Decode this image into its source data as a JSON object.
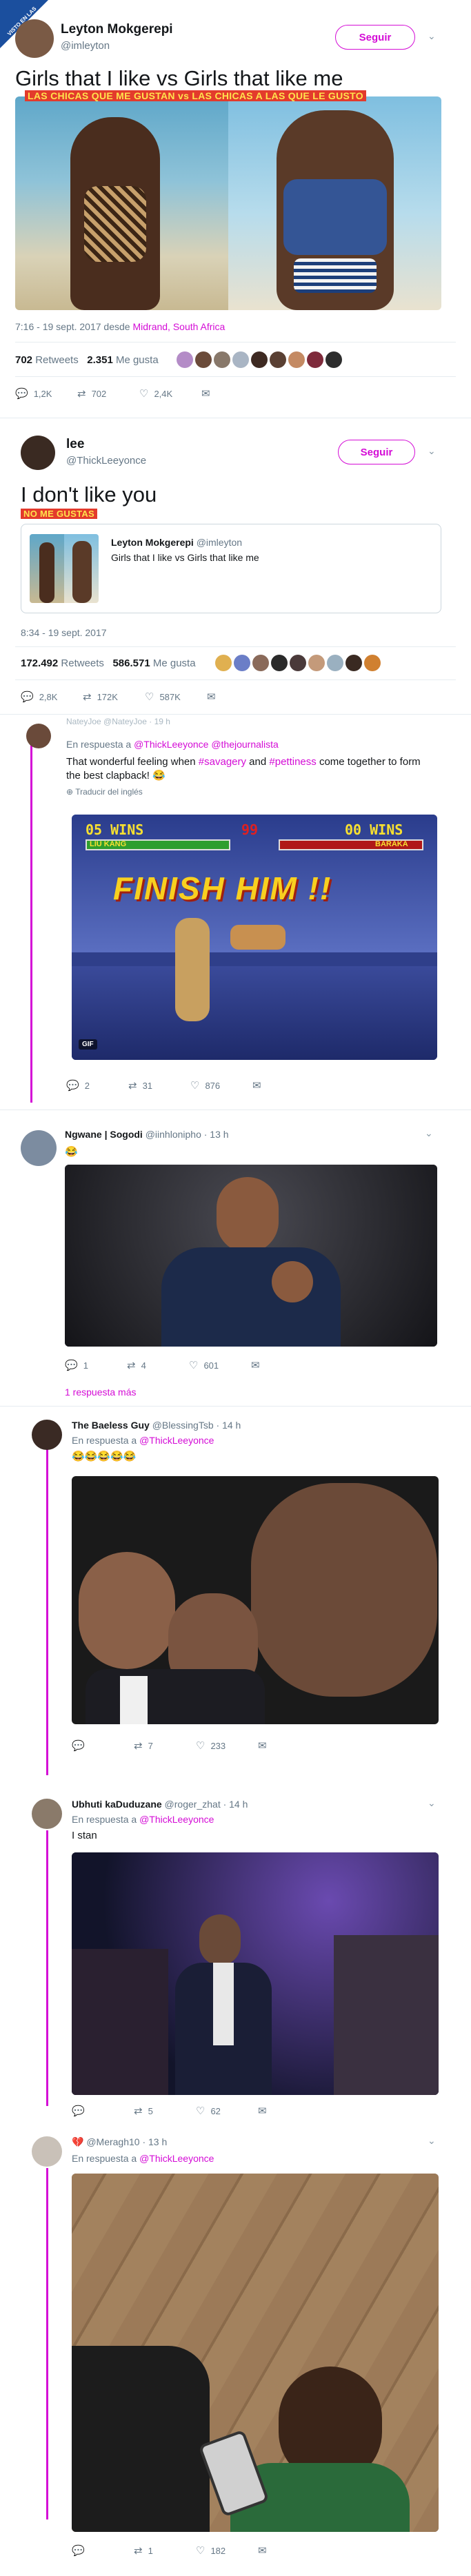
{
  "watermark": {
    "text": "VISTO EN LAS REDES"
  },
  "tweet1": {
    "name": "Leyton Mokgerepi",
    "handle": "@imleyton",
    "follow": "Seguir",
    "text": "Girls that I like vs Girls  that like me",
    "caption": "LAS CHICAS QUE ME GUSTAN vs LAS CHICAS A LAS QUE LE GUSTO",
    "time": "7:16 - 19 sept. 2017 desde ",
    "place": "Midrand, South Africa",
    "retweets": "702",
    "retweets_label": " Retweets",
    "likes": "2.351",
    "likes_label": " Me gusta",
    "actions": {
      "reply": "1,2K",
      "retweet": "702",
      "like": "2,4K"
    }
  },
  "tweet2": {
    "name": "lee",
    "handle": "@ThickLeeyonce",
    "follow": "Seguir",
    "text": "I don't like you",
    "caption": "NO ME GUSTAS",
    "quote_name": "Leyton Mokgerepi",
    "quote_handle": "@imleyton",
    "quote_text": "Girls that I like vs Girls  that like me",
    "time": "8:34 - 19 sept. 2017",
    "retweets": "172.492",
    "retweets_label": " Retweets",
    "likes": "586.571",
    "likes_label": " Me gusta",
    "actions": {
      "reply": "2,8K",
      "retweet": "172K",
      "like": "587K"
    }
  },
  "reply1": {
    "header": "NateyJoe @NateyJoe · 19 h",
    "in_reply": "En respuesta a ",
    "mentions": "@ThickLeeyonce @thejournalista",
    "text_a": "That wonderful feeling when ",
    "tag1": "#savagery",
    "text_b": " and ",
    "tag2": "#pettiness",
    "text_c": " come together to form the best clapback! 😂",
    "translate": "Traducir del inglés",
    "game": {
      "p1": "05 WINS",
      "p2": "00 WINS",
      "timer": "99",
      "n1": "LIU KANG",
      "n2": "BARAKA",
      "finish": "FINISH HIM !!",
      "badge": "GIF"
    },
    "actions": {
      "reply": "2",
      "retweet": "31",
      "like": "876"
    }
  },
  "reply2": {
    "name": "Ngwane | Sogodi",
    "handle": " @iinhloniphо · 13 h",
    "text": "😂",
    "actions": {
      "reply": "1",
      "retweet": "4",
      "like": "601"
    },
    "more": "1 respuesta más"
  },
  "reply3": {
    "name": "The Baeless Guy",
    "handle": " @BlessingTsb · 14 h",
    "in_reply": "En respuesta a ",
    "mention": "@ThickLeeyonce",
    "text": "😂😂😂😂😂",
    "actions": {
      "reply": "",
      "retweet": "7",
      "like": "233"
    }
  },
  "reply4": {
    "name": "Ubhuti kaDuduzane",
    "handle": " @roger_zhat · 14 h",
    "in_reply": "En respuesta a ",
    "mention": "@ThickLeeyonce",
    "text": "I stan",
    "actions": {
      "reply": "",
      "retweet": "5",
      "like": "62"
    }
  },
  "reply5": {
    "name": "",
    "handle": "@Meragh10 · 13 h",
    "in_reply": "En respuesta a ",
    "mention": "@ThickLeeyonce",
    "actions": {
      "reply": "",
      "retweet": "1",
      "like": "182"
    }
  }
}
